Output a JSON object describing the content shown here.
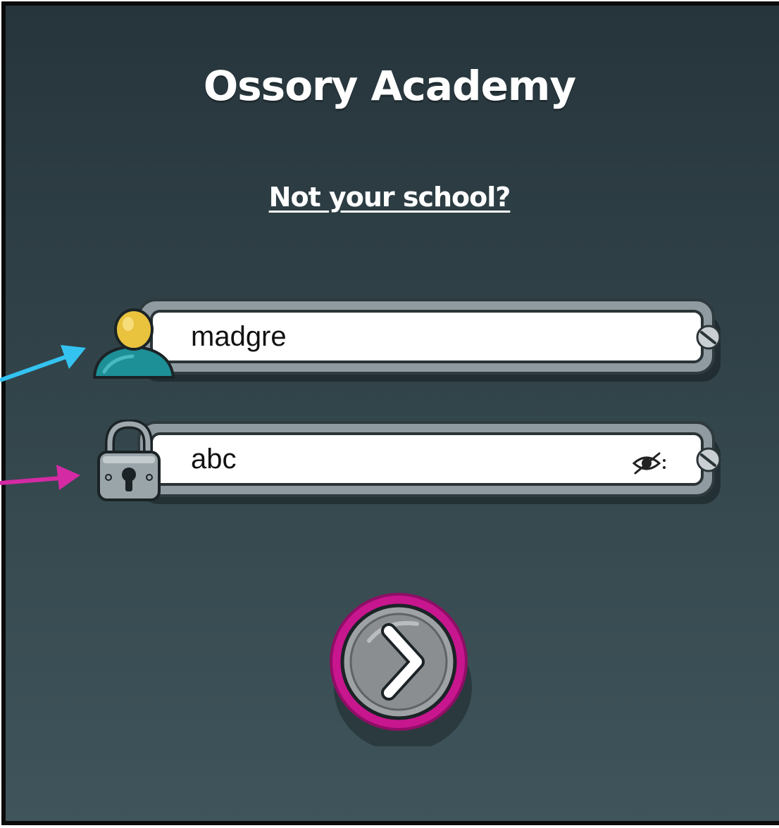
{
  "login": {
    "school_name": "Ossory Academy",
    "not_your_school": "Not your school?",
    "username_value": "madgre",
    "password_value": "abc"
  },
  "icons": {
    "user": "user-icon",
    "lock": "padlock-icon",
    "eye": "eye-slash-icon",
    "screw": "screw-icon",
    "go": "chevron-right-icon"
  },
  "colors": {
    "background_top": "#26353b",
    "background_bottom": "#3f555b",
    "username_arrow": "#34c3f1",
    "password_arrow": "#d42aa4",
    "go_button_ring": "#c8168f"
  }
}
